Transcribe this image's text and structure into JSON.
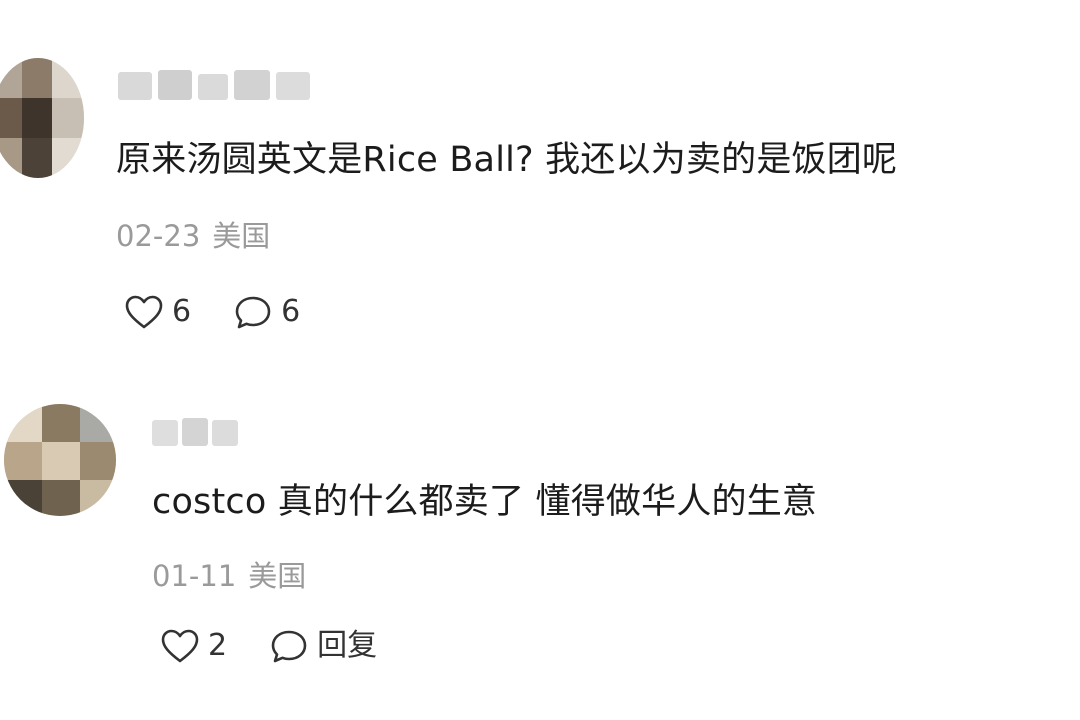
{
  "comments": [
    {
      "text": "原来汤圆英文是Rice Ball? 我还以为卖的是饭团呢",
      "date": "02-23",
      "location": "美国",
      "likes": "6",
      "reply_label": "6",
      "avatar_colors": [
        "#6b5a4a",
        "#c8bfb4",
        "#3e342c",
        "#a89886"
      ]
    },
    {
      "text": "costco 真的什么都卖了 懂得做华人的生意",
      "date": "01-11",
      "location": "美国",
      "likes": "2",
      "reply_label": "回复",
      "avatar_colors": [
        "#8a7a62",
        "#d9cbb3",
        "#4a4236",
        "#b8a58a"
      ]
    }
  ],
  "icons": {
    "like": "heart-outline-icon",
    "reply": "speech-bubble-outline-icon"
  },
  "colors": {
    "text": "#1c1c1c",
    "meta": "#9a9a9a",
    "icon": "#333333",
    "blur": "#d6d6d6"
  }
}
